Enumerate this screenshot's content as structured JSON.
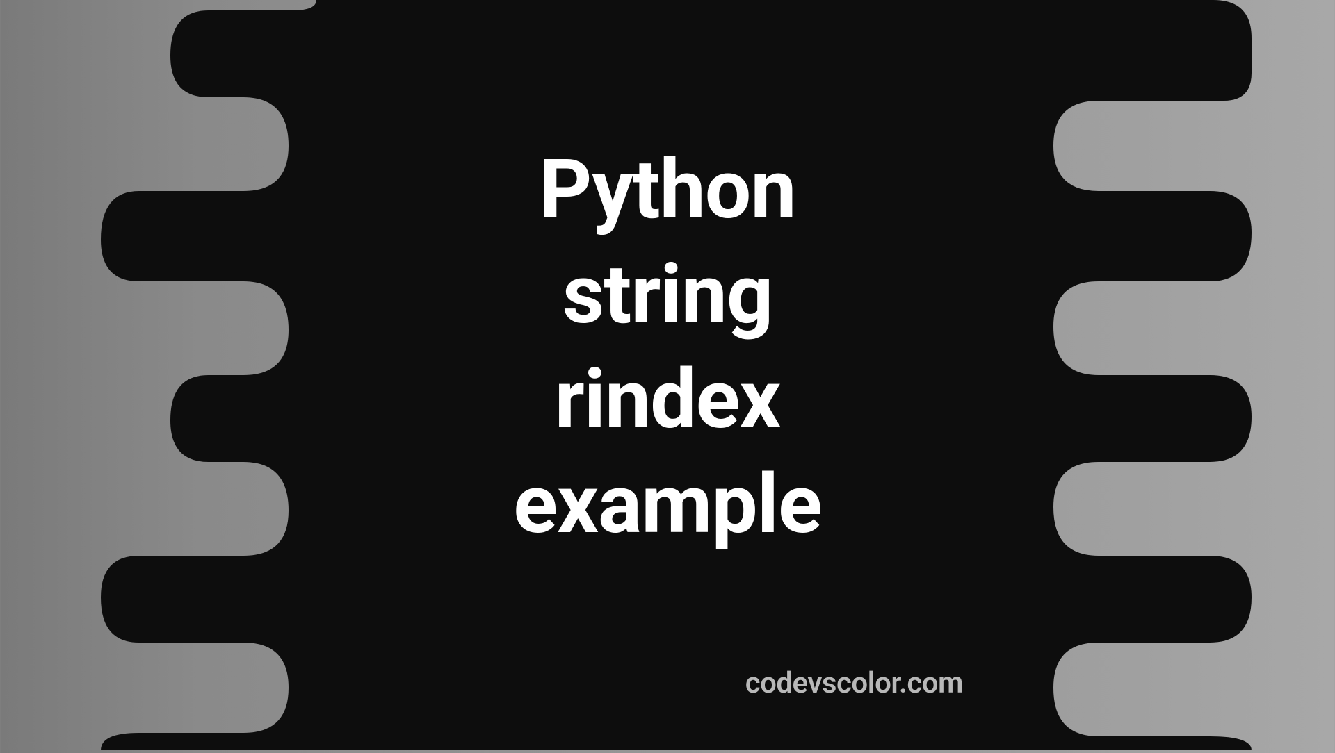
{
  "title": {
    "line1": "Python",
    "line2": "string",
    "line3": "rindex",
    "line4": "example"
  },
  "watermark": "codevscolor.com",
  "colors": {
    "shape_fill": "#0d0d0d",
    "text": "#ffffff",
    "watermark": "#b8b8b8"
  }
}
